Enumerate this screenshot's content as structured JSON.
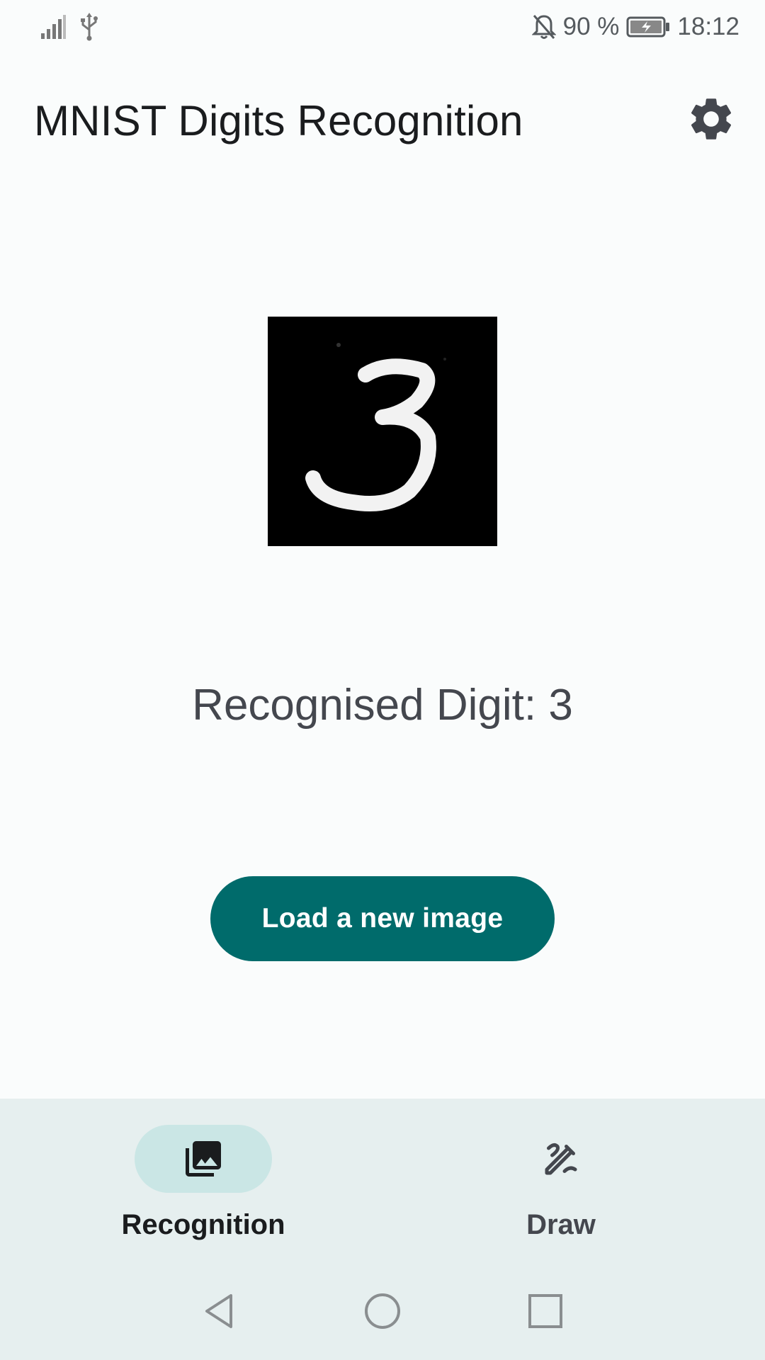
{
  "status_bar": {
    "battery_text": "90 %",
    "time": "18:12",
    "icons": [
      "signal-icon",
      "usb-icon",
      "notifications-off-icon",
      "battery-charging-icon"
    ]
  },
  "app_bar": {
    "title": "MNIST Digits Recognition",
    "settings_icon": "gear-icon"
  },
  "main": {
    "image_description": "handwritten digit image",
    "result_label": "Recognised Digit: 3",
    "load_button_label": "Load a new image"
  },
  "bottom_nav": {
    "items": [
      {
        "label": "Recognition",
        "icon": "photo-library-icon",
        "selected": true
      },
      {
        "label": "Draw",
        "icon": "draw-icon",
        "selected": false
      }
    ]
  },
  "system_nav": {
    "icons": [
      "back-icon",
      "home-icon",
      "recents-icon"
    ]
  },
  "colors": {
    "accent": "#006b6b",
    "nav_pill": "#cae6e5",
    "nav_background": "#e6efef",
    "background": "#fafcfc"
  }
}
